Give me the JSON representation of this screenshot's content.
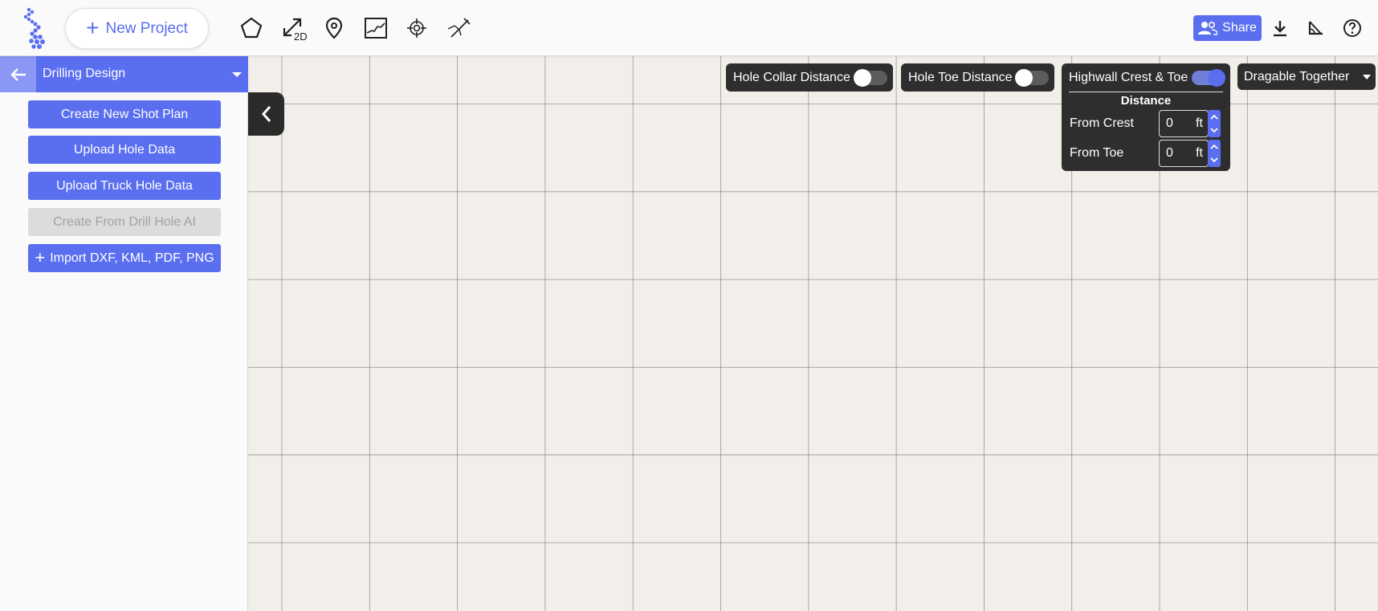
{
  "topbar": {
    "new_project_label": "New Project",
    "tools": [
      "polygon-icon",
      "measure-2d-icon",
      "location-pin-icon",
      "profile-chart-icon",
      "target-icon",
      "drill-icon"
    ],
    "measure_badge": "2D",
    "share_label": "Share"
  },
  "sidebar": {
    "title": "Drilling Design",
    "buttons": [
      "Create New Shot Plan",
      "Upload Hole Data",
      "Upload Truck Hole Data",
      "Create From Drill Hole AI",
      "Import DXF, KML, PDF, PNG"
    ]
  },
  "panels": {
    "hole_collar": {
      "label": "Hole Collar Distance",
      "on": false
    },
    "hole_toe": {
      "label": "Hole Toe Distance",
      "on": false
    },
    "highwall": {
      "label": "Highwall Crest & Toe",
      "on": true,
      "section_title": "Distance",
      "from_crest_label": "From Crest",
      "from_crest_value": "0",
      "from_toe_label": "From Toe",
      "from_toe_value": "0",
      "unit": "ft"
    },
    "dragable": {
      "label": "Dragable Together"
    }
  },
  "colors": {
    "accent": "#5a6ef0",
    "panel_dark": "#2e2e2e",
    "canvas_bg": "#f2efea",
    "grid_line": "#7a7a7a"
  }
}
